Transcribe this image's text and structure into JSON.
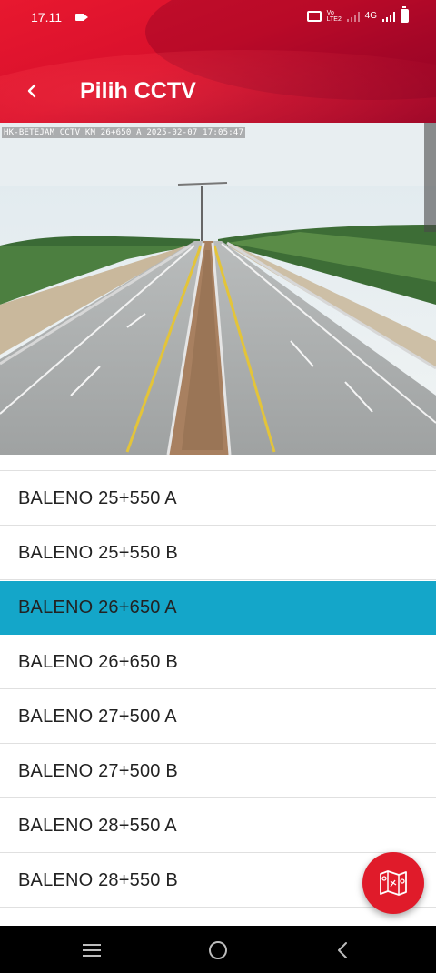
{
  "status_bar": {
    "time": "17.11",
    "volte_label": "Vo LTE2",
    "network_label": "4G"
  },
  "header": {
    "title": "Pilih CCTV"
  },
  "camera": {
    "overlay_text": "HK-BETEJAM CCTV KM 26+650 A 2025-02-07 17:05:47"
  },
  "cctv_list": {
    "items": [
      {
        "label": "BALENO 25+550 A",
        "selected": false
      },
      {
        "label": "BALENO 25+550 B",
        "selected": false
      },
      {
        "label": "BALENO 26+650 A",
        "selected": true
      },
      {
        "label": "BALENO 26+650 B",
        "selected": false
      },
      {
        "label": "BALENO 27+500 A",
        "selected": false
      },
      {
        "label": "BALENO 27+500 B",
        "selected": false
      },
      {
        "label": "BALENO 28+550 A",
        "selected": false
      },
      {
        "label": "BALENO 28+550 B",
        "selected": false
      }
    ]
  },
  "fab": {
    "icon": "map-icon"
  },
  "nav": {
    "icons": [
      "menu-icon",
      "home-icon",
      "back-icon"
    ]
  },
  "colors": {
    "header_red": "#d8102c",
    "selected_row": "#14a6c9",
    "fab_red": "#e01b2a"
  }
}
